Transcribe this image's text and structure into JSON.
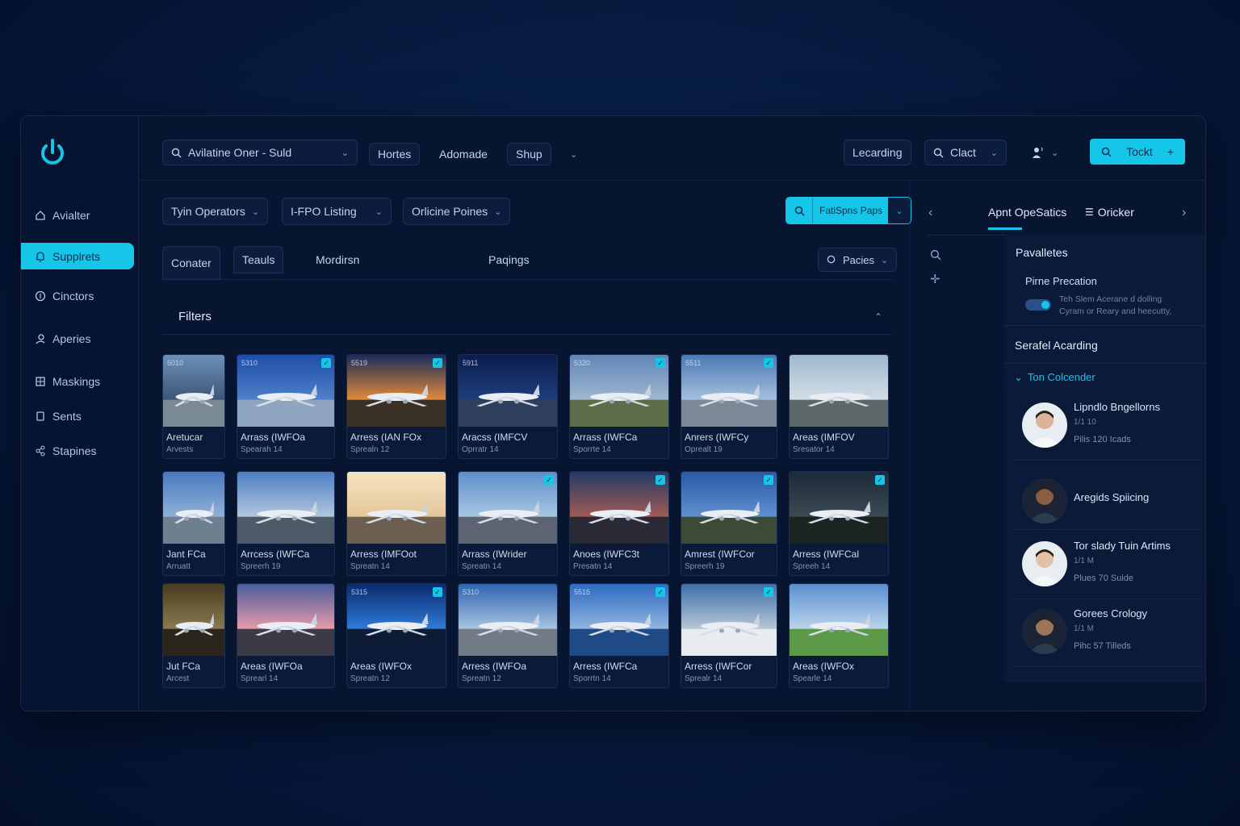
{
  "sidebar": {
    "items": [
      {
        "label": "Avialter",
        "icon": "home-icon"
      },
      {
        "label": "Supplrets",
        "icon": "bell-icon"
      },
      {
        "label": "Cinctors",
        "icon": "circle-icon"
      },
      {
        "label": "Aperies",
        "icon": "user-icon"
      },
      {
        "label": "Maskings",
        "icon": "grid-icon"
      },
      {
        "label": "Sents",
        "icon": "clipboard-icon"
      },
      {
        "label": "Stapines",
        "icon": "share-icon"
      }
    ],
    "accent": "#15c6e9"
  },
  "topbar": {
    "search_text": "Avilatine Oner - Suld",
    "nav1": "Hortes",
    "nav2": "Adomade",
    "nav3": "Shup",
    "learning": "Lecarding",
    "client": "Clact",
    "action_label": "Tockt",
    "action_plus": "+"
  },
  "filters_row": {
    "f1": "Tyin Operators",
    "f2": "I-FPO Listing",
    "f3": "Orlicine Poines",
    "search_btn": "FatiSpns Paps"
  },
  "tabs": {
    "t1": "Conater",
    "t2": "Teauls",
    "t3": "Mordirsn",
    "t4": "Paqings",
    "sort": "Pacies"
  },
  "filters_title": "Filters",
  "cards": [
    {
      "tag": "5010",
      "title": "Aretucar",
      "sub": "Arvests",
      "checked": false
    },
    {
      "tag": "5310",
      "title": "Arrass (IWFOa",
      "sub": "Spearah 14",
      "checked": true
    },
    {
      "tag": "5519",
      "title": "Arress (IAN FOx",
      "sub": "Sprealn 12",
      "checked": true
    },
    {
      "tag": "5911",
      "title": "Aracss (IMFCV",
      "sub": "Oprratr 14",
      "checked": false
    },
    {
      "tag": "5320",
      "title": "Arrass (IWFCa",
      "sub": "Sporrte 14",
      "checked": true
    },
    {
      "tag": "5511",
      "title": "Anrers (IWFCy",
      "sub": "Oprealt 19",
      "checked": true
    },
    {
      "tag": "",
      "title": "Areas (IMFOV",
      "sub": "Sresator 14",
      "checked": false
    },
    {
      "tag": "",
      "title": "Jant FCa",
      "sub": "Arruatt",
      "checked": false
    },
    {
      "tag": "",
      "title": "Arrcess (IWFCa",
      "sub": "Spreerh 19",
      "checked": false
    },
    {
      "tag": "",
      "title": "Arress (IMFOot",
      "sub": "Spreatn 14",
      "checked": false
    },
    {
      "tag": "",
      "title": "Arrass (IWrider",
      "sub": "Spreatn 14",
      "checked": true
    },
    {
      "tag": "",
      "title": "Anoes (IWFC3t",
      "sub": "Presatn 14",
      "checked": true
    },
    {
      "tag": "",
      "title": "Amrest (IWFCor",
      "sub": "Spreerh 19",
      "checked": true
    },
    {
      "tag": "",
      "title": "Arress (IWFCal",
      "sub": "Spreeh 14",
      "checked": true
    },
    {
      "tag": "",
      "title": "Jut FCa",
      "sub": "Arcest",
      "checked": false
    },
    {
      "tag": "",
      "title": "Areas (IWFOa",
      "sub": "Sprearl 14",
      "checked": false
    },
    {
      "tag": "5315",
      "title": "Areas (IWFOx",
      "sub": "Spreatn 12",
      "checked": true
    },
    {
      "tag": "5310",
      "title": "Arress (IWFOa",
      "sub": "Spreatn 12",
      "checked": false
    },
    {
      "tag": "5515",
      "title": "Arress (IWFCa",
      "sub": "Sporrtn 14",
      "checked": true
    },
    {
      "tag": "",
      "title": "Arress (IWFCor",
      "sub": "Sprealr 14",
      "checked": true
    },
    {
      "tag": "",
      "title": "Areas (IWFOx",
      "sub": "Spearle 14",
      "checked": false
    }
  ],
  "right_panel": {
    "tab_active": "Apnt OpeSatics",
    "tab2": "Oricker",
    "section1_title": "Pavalletes",
    "setting_label": "Pirne  Precation",
    "setting_desc1": "Teh Slem Acerane d dolling",
    "setting_desc2": "Cyram or Reary and heecutty,",
    "section2_title": "Serafel Acarding",
    "group_label": "Ton Colcender",
    "people": [
      {
        "name": "Lipndlo Bngellorns",
        "meta": "1/1 10",
        "line": "Pilis 120 Icads"
      },
      {
        "name": "Aregids Spiicing",
        "meta": "",
        "line": ""
      },
      {
        "name": "Tor slady Tuin Artims",
        "meta": "1/1 M",
        "line": "Plues 70 Suide"
      },
      {
        "name": "Gorees Crology",
        "meta": "1/1 M",
        "line": "Pihc 57 Tilleds"
      }
    ]
  }
}
